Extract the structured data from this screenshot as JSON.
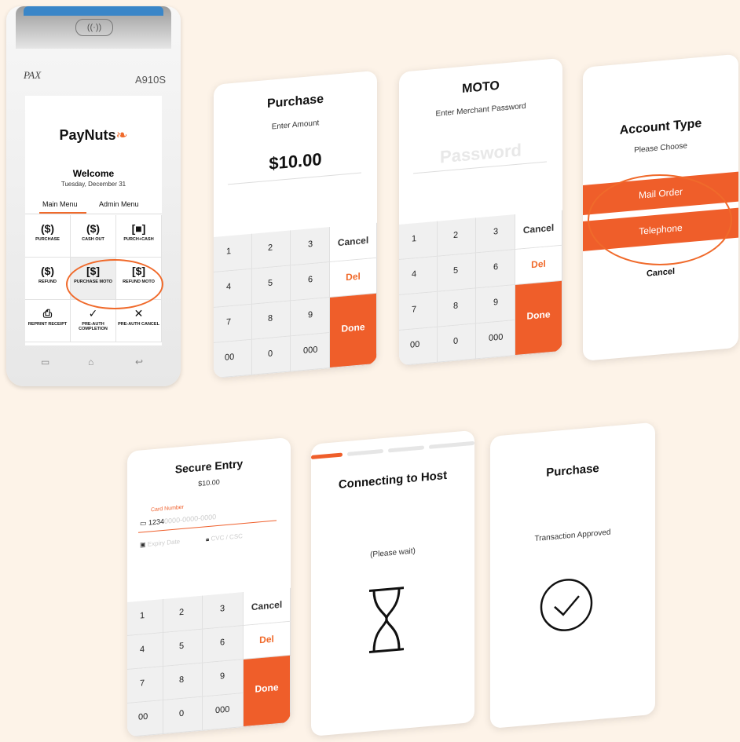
{
  "terminal": {
    "brand_logo": "PAX",
    "model": "A910S",
    "app_name": "PayNuts",
    "welcome": "Welcome",
    "date": "Tuesday, December 31",
    "tabs": [
      "Main Menu",
      "Admin Menu"
    ],
    "menu": [
      {
        "icon": "($)",
        "label": "PURCHASE"
      },
      {
        "icon": "($)",
        "label": "CASH OUT"
      },
      {
        "icon": "[■]",
        "label": "PURCH+CASH"
      },
      {
        "icon": "($)",
        "label": "REFUND"
      },
      {
        "icon": "[$]",
        "label": "PURCHASE MOTO"
      },
      {
        "icon": "[$]",
        "label": "REFUND MOTO"
      },
      {
        "icon": "⎙",
        "label": "REPRINT RECEIPT"
      },
      {
        "icon": "✓",
        "label": "PRE-AUTH COMPLETION"
      },
      {
        "icon": "✕",
        "label": "PRE-AUTH CANCEL"
      }
    ],
    "nav_icons": [
      "▭",
      "⌂",
      "↩"
    ]
  },
  "screens": {
    "purchase": {
      "title": "Purchase",
      "prompt": "Enter Amount",
      "amount": "$10.00"
    },
    "moto": {
      "title": "MOTO",
      "prompt": "Enter Merchant Password",
      "placeholder": "Password"
    },
    "account": {
      "title": "Account Type",
      "prompt": "Please Choose",
      "options": [
        "Mail Order",
        "Telephone"
      ],
      "cancel": "Cancel"
    },
    "secure": {
      "title": "Secure Entry",
      "amount": "$10.00",
      "card_label": "Card Number",
      "card_value": "1234",
      "card_placeholder": "0000-0000-0000",
      "expiry_placeholder": "Expiry Date",
      "cvc_placeholder": "CVC / CSC"
    },
    "connecting": {
      "title": "Connecting to Host",
      "status": "(Please wait)"
    },
    "approved": {
      "title": "Purchase",
      "status": "Transaction Approved"
    }
  },
  "keypad": {
    "keys": [
      "1",
      "2",
      "3",
      "4",
      "5",
      "6",
      "7",
      "8",
      "9",
      "00",
      "0",
      "000"
    ],
    "cancel": "Cancel",
    "del": "Del",
    "done": "Done"
  },
  "colors": {
    "accent": "#ef5e2a",
    "background": "#fdf3e8"
  }
}
